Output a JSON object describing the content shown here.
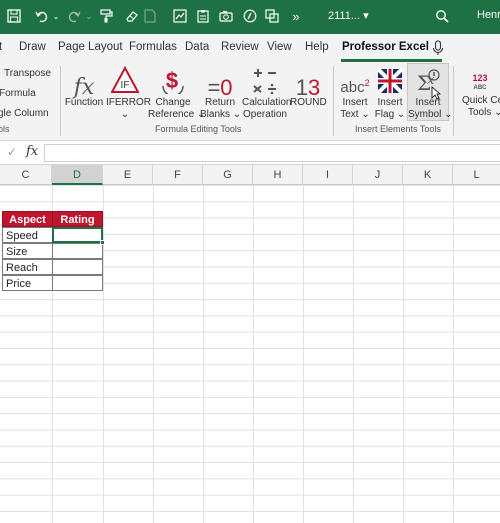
{
  "titlebar": {
    "file_name": "2111... ▾",
    "user": "Henrik",
    "quick_access": [
      "save-icon",
      "undo-icon",
      "redo-icon",
      "format-painter-icon",
      "new-icon",
      "chart-icon",
      "paste-icon",
      "camera-icon",
      "formula-icon",
      "copy-icon",
      "more-icon"
    ],
    "more": "»",
    "accent": "#1e7145"
  },
  "tabs": [
    "t",
    "Draw",
    "Page Layout",
    "Formulas",
    "Data",
    "Review",
    "View",
    "Help",
    "Professor Excel"
  ],
  "active_tab": "Professor Excel",
  "ribbon": {
    "left_tools": [
      "Transpose",
      "Formula",
      "gle Column"
    ],
    "left_group": "ols",
    "buttons": {
      "function": "Function",
      "iferror": "IFERROR",
      "change_reference": [
        "Change",
        "Reference ⌄"
      ],
      "return_blanks": [
        "Return",
        "Blanks ⌄"
      ],
      "calculation_operation": [
        "Calculation",
        "Operation"
      ],
      "round": "ROUND",
      "insert_text": [
        "Insert",
        "Text ⌄"
      ],
      "insert_flag": [
        "Insert",
        "Flag ⌄"
      ],
      "insert_symbol": [
        "Insert",
        "Symbol ⌄"
      ],
      "quick_ce": [
        "Quick Ce",
        "Tools ⌄"
      ]
    },
    "iferror_chevron": "⌄",
    "groups": {
      "formula_editing": "Formula Editing Tools",
      "insert_elements": "Insert Elements Tools"
    }
  },
  "formula_bar": {
    "check": "✓",
    "fx": "fx",
    "value": ""
  },
  "columns": [
    "C",
    "D",
    "E",
    "F",
    "G",
    "H",
    "I",
    "J",
    "K",
    "L"
  ],
  "selected_column": "D",
  "table": {
    "headers": [
      "Aspect",
      "Rating"
    ],
    "rows": [
      [
        "Speed",
        ""
      ],
      [
        "Size",
        ""
      ],
      [
        "Reach",
        ""
      ],
      [
        "Price",
        ""
      ]
    ],
    "header_color": "#c0152f"
  }
}
